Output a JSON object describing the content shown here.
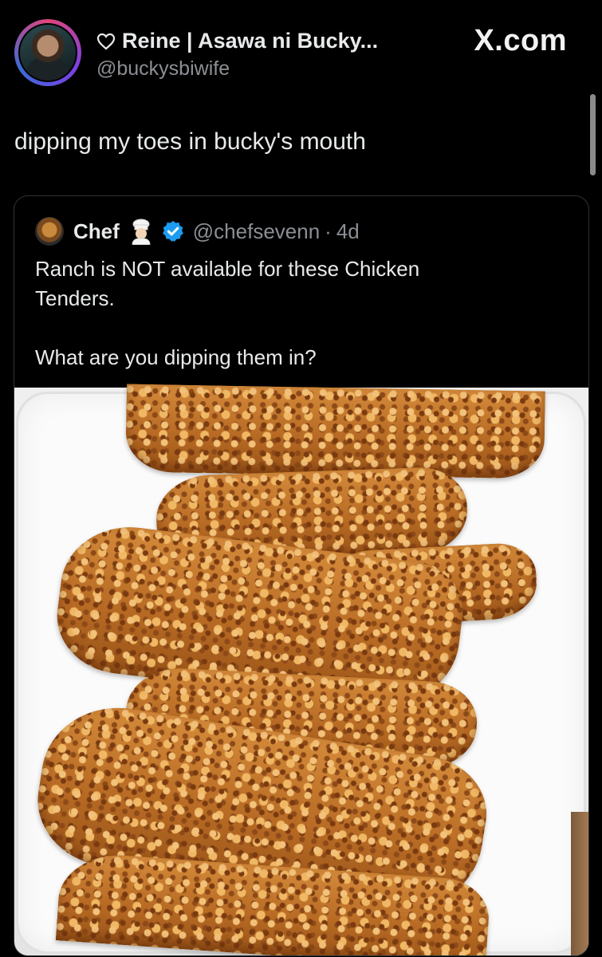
{
  "header": {
    "display_name": "Reine | Asawa ni Bucky...",
    "handle": "@buckysbiwife",
    "site_logo": "X.com",
    "icons": {
      "name_prefix": "heart-outline-icon"
    }
  },
  "tweet": {
    "text": "dipping my toes in bucky's mouth"
  },
  "quote": {
    "author_name": "Chef",
    "author_emoji": "chef-emoji-icon",
    "verified": "verified-badge-icon",
    "handle": "@chefsevenn",
    "separator": "·",
    "time": "4d",
    "body_lines": [
      "Ranch is NOT available for these Chicken",
      "Tenders."
    ],
    "body_question": "What are you dipping them in?",
    "media": "photo of fried chicken tenders on a white plate"
  },
  "colors": {
    "background": "#000000",
    "text_primary": "#e7e9ea",
    "text_secondary": "#8b8f94",
    "verified_blue": "#1d9bf0",
    "card_border": "#2f3336"
  }
}
